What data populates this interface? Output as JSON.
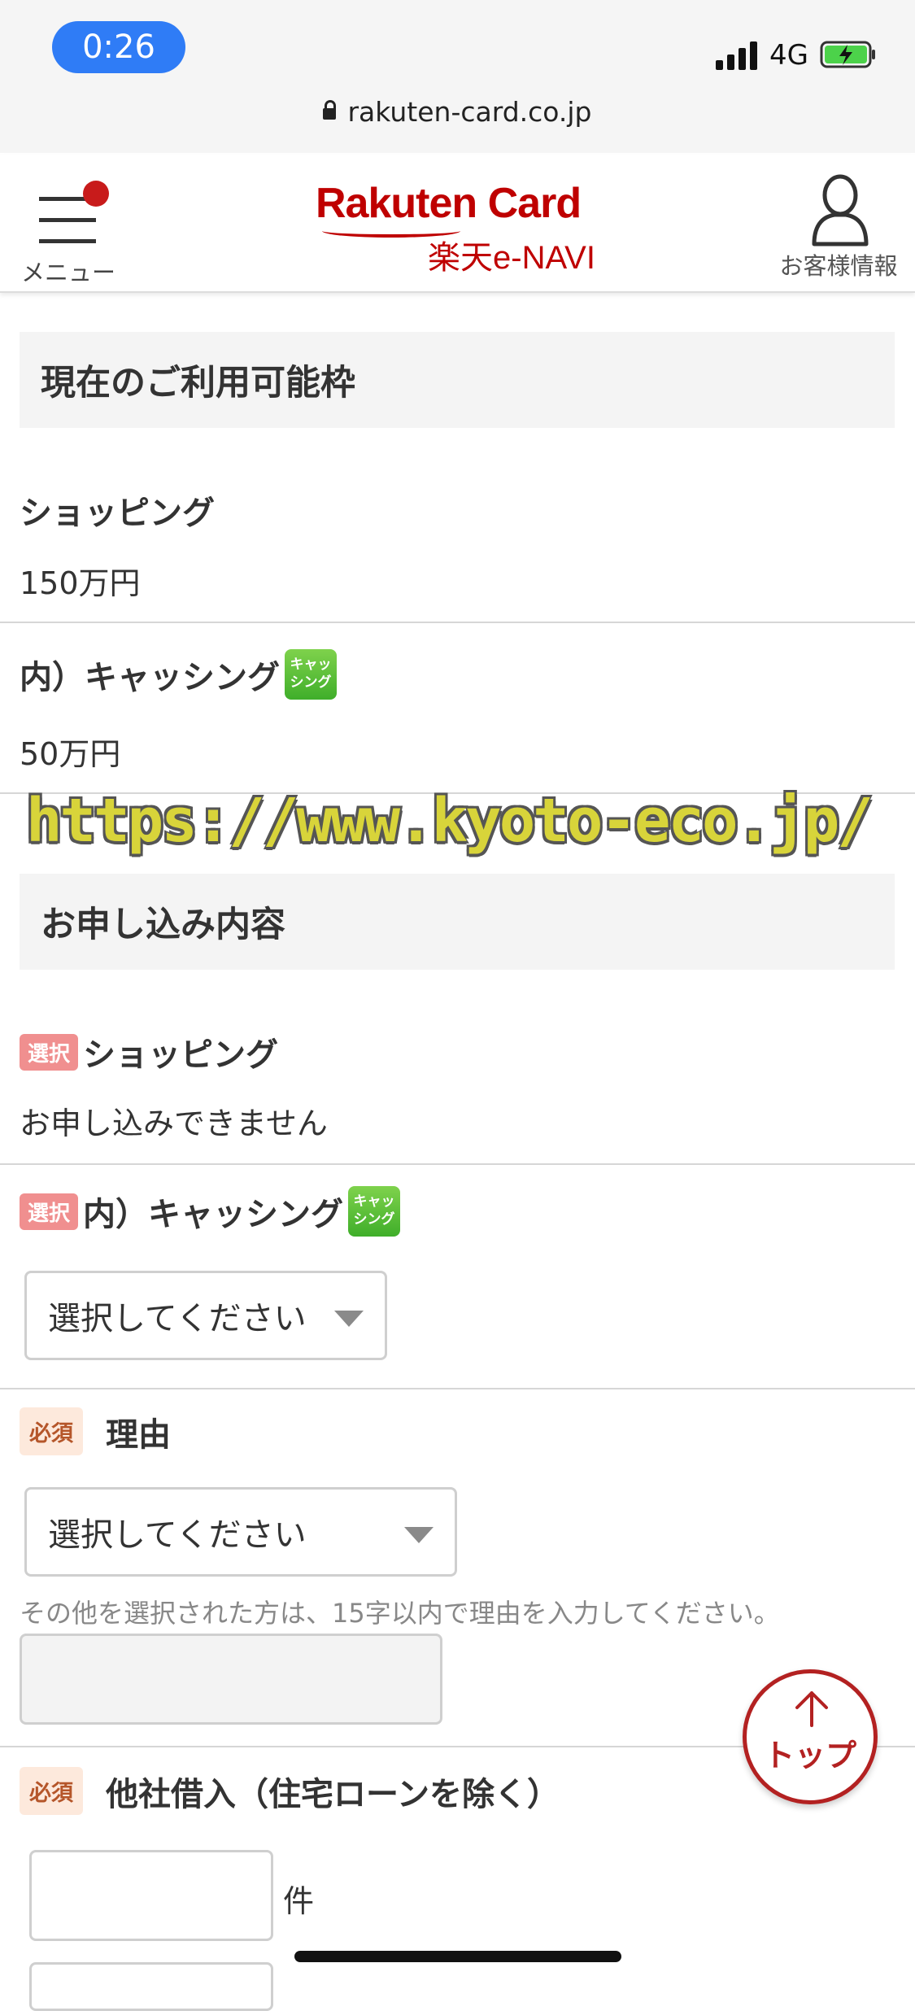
{
  "status_bar": {
    "time": "0:26",
    "network": "4G"
  },
  "browser": {
    "url": "rakuten-card.co.jp"
  },
  "header": {
    "menu_label": "メニュー",
    "logo_top": "Rakuten Card",
    "logo_bottom": "楽天e-NAVI",
    "account_label": "お客様情報"
  },
  "available_limit": {
    "title": "現在のご利用可能枠",
    "shopping_label": "ショッピング",
    "shopping_value": "150万円",
    "cashing_label": "内）キャッシング",
    "cashing_value": "50万円",
    "cashing_badge": "キャッシング"
  },
  "watermark": "https://www.kyoto-eco.jp/",
  "application": {
    "title": "お申し込み内容",
    "select_badge": "選択",
    "required_badge": "必須",
    "shopping_label": "ショッピング",
    "shopping_status": "お申し込みできません",
    "cashing_label": "内）キャッシング",
    "cashing_select": "選択してください",
    "reason_label": "理由",
    "reason_select": "選択してください",
    "reason_note": "その他を選択された方は、15字以内で理由を入力してください。",
    "other_loans_label": "他社借入（住宅ローンを除く）",
    "count_unit": "件"
  },
  "scroll_top": {
    "label": "トップ"
  },
  "colors": {
    "brand_red": "#bf0000",
    "ios_blue": "#2f7cf6",
    "cashing_green": "#4cb92f"
  }
}
